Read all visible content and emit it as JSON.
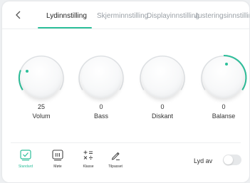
{
  "header": {
    "back_icon": "chevron-left-icon",
    "tabs": [
      {
        "label": "Lydinnstilling",
        "active": true
      },
      {
        "label": "Skjerminnstilling",
        "active": false
      },
      {
        "label": "Displayinnstilling",
        "active": false
      },
      {
        "label": "Justeringsinnstilling",
        "active": false
      }
    ]
  },
  "knobs": [
    {
      "label": "Volum",
      "value": "25"
    },
    {
      "label": "Bass",
      "value": "0"
    },
    {
      "label": "Diskant",
      "value": "0"
    },
    {
      "label": "Balanse",
      "value": "0"
    }
  ],
  "modes": [
    {
      "label": "Standard",
      "icon": "check-square-icon",
      "active": true
    },
    {
      "label": "Møte",
      "icon": "meeting-icon",
      "active": false
    },
    {
      "label": "Klasse",
      "icon": "math-symbols-icon",
      "active": false
    },
    {
      "label": "Tilpasset",
      "icon": "pen-icon",
      "active": false
    }
  ],
  "sound_off": {
    "label": "Lyd av",
    "on": false
  },
  "colors": {
    "accent": "#2dbf9a",
    "track": "#dfe2e5"
  }
}
